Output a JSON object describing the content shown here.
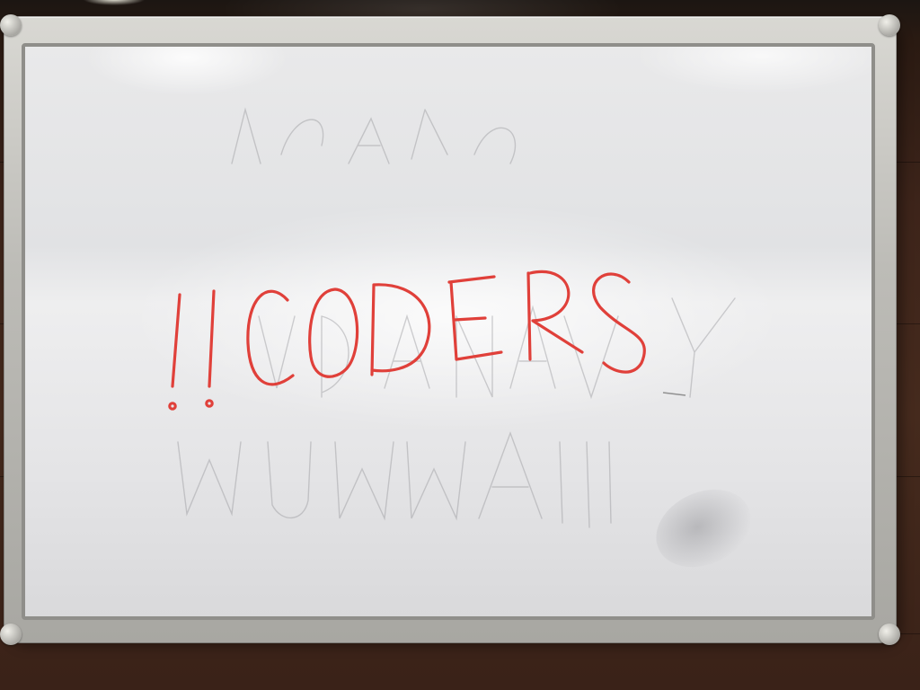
{
  "scene": {
    "subject": "whiteboard",
    "marker_text": "!!CODERS",
    "marker_color": "#e0403a",
    "frame_color": "#bdbcb7",
    "wall_color": "#452a1d",
    "board_color": "#e4e4e6"
  }
}
